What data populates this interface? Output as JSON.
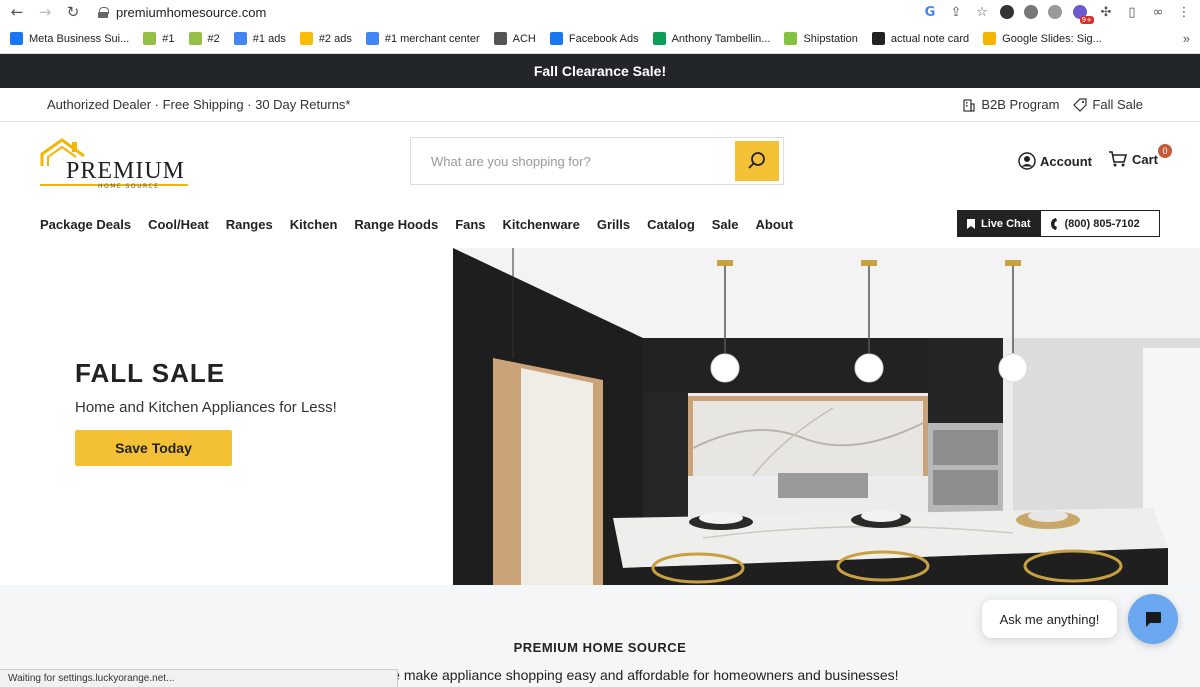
{
  "browser": {
    "url": "premiumhomesource.com",
    "bookmarks": [
      {
        "label": "Meta Business Sui...",
        "icon": "meta-icon",
        "color": "#1877f2"
      },
      {
        "label": "#1",
        "icon": "shopify-icon",
        "color": "#95bf47"
      },
      {
        "label": "#2",
        "icon": "shopify-icon",
        "color": "#95bf47"
      },
      {
        "label": "#1 ads",
        "icon": "google-icon",
        "color": "#4285f4"
      },
      {
        "label": "#2 ads",
        "icon": "google-ads-icon",
        "color": "#fbbc04"
      },
      {
        "label": "#1 merchant center",
        "icon": "merchant-center-icon",
        "color": "#4285f4"
      },
      {
        "label": "ACH",
        "icon": "globe-icon",
        "color": "#555555"
      },
      {
        "label": "Facebook Ads",
        "icon": "meta-icon",
        "color": "#1877f2"
      },
      {
        "label": "Anthony Tambellin...",
        "icon": "sheets-icon",
        "color": "#0f9d58"
      },
      {
        "label": "Shipstation",
        "icon": "gear-icon",
        "color": "#84c341"
      },
      {
        "label": "actual note card",
        "icon": "z-icon",
        "color": "#222222"
      },
      {
        "label": "Google Slides: Sig...",
        "icon": "slides-icon",
        "color": "#f4b400"
      }
    ],
    "bookmarks_more": "»",
    "ext_badge": "9+",
    "status_text": "Waiting for settings.luckyorange.net..."
  },
  "site": {
    "announcement": "Fall Clearance Sale!",
    "utility_left": "Authorized Dealer · Free Shipping · 30 Day Returns*",
    "utility_links": [
      {
        "label": "B2B Program",
        "icon": "building-icon"
      },
      {
        "label": "Fall Sale",
        "icon": "tag-icon"
      }
    ],
    "logo": {
      "main": "PREMIUM",
      "sub": "HOME SOURCE"
    },
    "search_placeholder": "What are you shopping for?",
    "account_label": "Account",
    "cart_label": "Cart",
    "cart_count": "0",
    "nav": [
      "Package Deals",
      "Cool/Heat",
      "Ranges",
      "Kitchen",
      "Range Hoods",
      "Fans",
      "Kitchenware",
      "Grills",
      "Catalog",
      "Sale",
      "About"
    ],
    "live_chat_label": "Live Chat",
    "phone_label": "(800) 805-7102",
    "hero": {
      "title": "FALL SALE",
      "subtitle": "Home and Kitchen Appliances for Less!",
      "cta": "Save Today"
    },
    "section_title": "PREMIUM HOME SOURCE",
    "section_text": "eam Prices. We make appliance shopping easy and affordable for homeowners and businesses!",
    "chat_prompt": "Ask me anything!"
  },
  "colors": {
    "accent": "#f4c035",
    "announcement_bg": "#222629",
    "chat_button": "#6ba7f0"
  }
}
